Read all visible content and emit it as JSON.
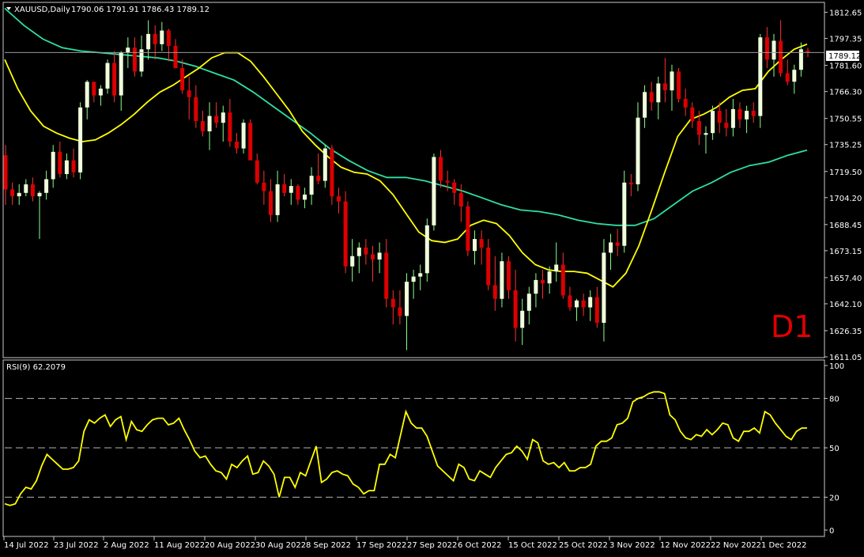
{
  "header": {
    "symbol_label": "XAUUSD,Daily",
    "ohlc": "1790.06 1791.91 1786.43 1789.12"
  },
  "price_badge": "1789.12",
  "timeframe_label": "D1",
  "rsi_label": "RSI(9) 62.2079",
  "price_axis_labels": [
    "1812.65",
    "1797.35",
    "1781.60",
    "1766.30",
    "1750.55",
    "1735.25",
    "1719.50",
    "1704.20",
    "1688.45",
    "1673.15",
    "1657.40",
    "1642.10",
    "1626.35",
    "1611.05"
  ],
  "rsi_axis_labels": [
    "100",
    "80",
    "50",
    "20",
    "0"
  ],
  "date_labels": [
    "14 Jul 2022",
    "23 Jul 2022",
    "2 Aug 2022",
    "11 Aug 2022",
    "20 Aug 2022",
    "30 Aug 2022",
    "8 Sep 2022",
    "17 Sep 2022",
    "27 Sep 2022",
    "6 Oct 2022",
    "15 Oct 2022",
    "25 Oct 2022",
    "3 Nov 2022",
    "12 Nov 2022",
    "22 Nov 2022",
    "1 Dec 2022"
  ],
  "colors": {
    "background": "#000000",
    "bull": "#f0ffdc",
    "bear": "#dc0000",
    "wick_bull": "#8cff8c",
    "wick_bear": "#ff3030",
    "ma_fast": "#ffff00",
    "ma_slow": "#2ee0a0",
    "rsi": "#ffff00",
    "grid": "#b4b4b4",
    "d1": "#e00000"
  },
  "chart_data": [
    {
      "type": "candlestick",
      "title": "XAUUSD,Daily",
      "ylim": [
        1611.05,
        1818
      ],
      "current_price": 1789.12,
      "series": [
        {
          "name": "candles",
          "ohlc": [
            [
              1729,
              1735,
              1700,
              1709
            ],
            [
              1709,
              1713,
              1700,
              1705
            ],
            [
              1705,
              1712,
              1700,
              1707
            ],
            [
              1707,
              1715,
              1705,
              1712
            ],
            [
              1712,
              1716,
              1702,
              1705
            ],
            [
              1705,
              1708,
              1680,
              1707
            ],
            [
              1707,
              1720,
              1703,
              1715
            ],
            [
              1715,
              1735,
              1710,
              1731
            ],
            [
              1731,
              1737,
              1716,
              1718
            ],
            [
              1718,
              1730,
              1715,
              1726
            ],
            [
              1726,
              1733,
              1716,
              1719
            ],
            [
              1719,
              1760,
              1715,
              1757
            ],
            [
              1757,
              1773,
              1750,
              1772
            ],
            [
              1772,
              1772,
              1760,
              1764
            ],
            [
              1764,
              1770,
              1758,
              1768
            ],
            [
              1768,
              1785,
              1765,
              1783
            ],
            [
              1783,
              1790,
              1760,
              1764
            ],
            [
              1764,
              1790,
              1755,
              1789
            ],
            [
              1789,
              1798,
              1780,
              1792
            ],
            [
              1792,
              1798,
              1775,
              1778
            ],
            [
              1778,
              1799,
              1775,
              1791
            ],
            [
              1791,
              1808,
              1785,
              1800
            ],
            [
              1800,
              1805,
              1785,
              1794
            ],
            [
              1794,
              1807,
              1790,
              1802
            ],
            [
              1802,
              1803,
              1784,
              1793
            ],
            [
              1793,
              1797,
              1780,
              1780
            ],
            [
              1780,
              1785,
              1765,
              1767
            ],
            [
              1767,
              1775,
              1750,
              1763
            ],
            [
              1763,
              1770,
              1745,
              1749
            ],
            [
              1749,
              1755,
              1740,
              1743
            ],
            [
              1743,
              1760,
              1732,
              1752
            ],
            [
              1752,
              1760,
              1745,
              1748
            ],
            [
              1748,
              1758,
              1737,
              1754
            ],
            [
              1754,
              1762,
              1734,
              1737
            ],
            [
              1737,
              1742,
              1730,
              1733
            ],
            [
              1733,
              1750,
              1730,
              1748
            ],
            [
              1748,
              1750,
              1728,
              1726
            ],
            [
              1726,
              1730,
              1712,
              1713
            ],
            [
              1713,
              1720,
              1700,
              1708
            ],
            [
              1708,
              1715,
              1690,
              1694
            ],
            [
              1694,
              1720,
              1690,
              1712
            ],
            [
              1712,
              1718,
              1705,
              1707
            ],
            [
              1707,
              1715,
              1700,
              1711
            ],
            [
              1711,
              1712,
              1700,
              1703
            ],
            [
              1703,
              1710,
              1698,
              1706
            ],
            [
              1706,
              1722,
              1700,
              1717
            ],
            [
              1717,
              1730,
              1712,
              1714
            ],
            [
              1714,
              1735,
              1710,
              1733
            ],
            [
              1733,
              1735,
              1700,
              1705
            ],
            [
              1705,
              1710,
              1695,
              1702
            ],
            [
              1702,
              1708,
              1660,
              1664
            ],
            [
              1664,
              1680,
              1655,
              1670
            ],
            [
              1670,
              1678,
              1660,
              1675
            ],
            [
              1675,
              1680,
              1665,
              1671
            ],
            [
              1671,
              1676,
              1655,
              1668
            ],
            [
              1668,
              1678,
              1660,
              1672
            ],
            [
              1672,
              1680,
              1640,
              1645
            ],
            [
              1645,
              1650,
              1630,
              1640
            ],
            [
              1640,
              1650,
              1630,
              1635
            ],
            [
              1635,
              1660,
              1615,
              1655
            ],
            [
              1655,
              1662,
              1645,
              1658
            ],
            [
              1658,
              1665,
              1650,
              1660
            ],
            [
              1660,
              1692,
              1655,
              1688
            ],
            [
              1688,
              1730,
              1685,
              1728
            ],
            [
              1728,
              1732,
              1710,
              1714
            ],
            [
              1714,
              1720,
              1708,
              1713
            ],
            [
              1713,
              1715,
              1700,
              1707
            ],
            [
              1707,
              1712,
              1690,
              1699
            ],
            [
              1699,
              1702,
              1670,
              1673
            ],
            [
              1673,
              1685,
              1665,
              1680
            ],
            [
              1680,
              1685,
              1665,
              1675
            ],
            [
              1675,
              1680,
              1650,
              1653
            ],
            [
              1653,
              1670,
              1638,
              1645
            ],
            [
              1645,
              1672,
              1640,
              1667
            ],
            [
              1667,
              1670,
              1645,
              1650
            ],
            [
              1650,
              1662,
              1620,
              1628
            ],
            [
              1628,
              1645,
              1618,
              1638
            ],
            [
              1638,
              1652,
              1630,
              1648
            ],
            [
              1648,
              1660,
              1640,
              1656
            ],
            [
              1656,
              1662,
              1645,
              1654
            ],
            [
              1654,
              1664,
              1648,
              1661
            ],
            [
              1661,
              1678,
              1655,
              1665
            ],
            [
              1665,
              1672,
              1645,
              1647
            ],
            [
              1647,
              1652,
              1638,
              1640
            ],
            [
              1640,
              1645,
              1632,
              1644
            ],
            [
              1644,
              1648,
              1635,
              1640
            ],
            [
              1640,
              1650,
              1632,
              1646
            ],
            [
              1646,
              1652,
              1628,
              1631
            ],
            [
              1631,
              1680,
              1620,
              1672
            ],
            [
              1672,
              1683,
              1662,
              1678
            ],
            [
              1678,
              1686,
              1670,
              1676
            ],
            [
              1676,
              1720,
              1672,
              1713
            ],
            [
              1713,
              1718,
              1705,
              1712
            ],
            [
              1712,
              1760,
              1708,
              1751
            ],
            [
              1751,
              1770,
              1745,
              1766
            ],
            [
              1766,
              1772,
              1755,
              1760
            ],
            [
              1760,
              1775,
              1750,
              1771
            ],
            [
              1771,
              1786,
              1760,
              1767
            ],
            [
              1767,
              1782,
              1755,
              1778
            ],
            [
              1778,
              1780,
              1760,
              1762
            ],
            [
              1762,
              1768,
              1752,
              1757
            ],
            [
              1757,
              1760,
              1745,
              1749
            ],
            [
              1749,
              1755,
              1735,
              1741
            ],
            [
              1741,
              1746,
              1730,
              1742
            ],
            [
              1742,
              1758,
              1738,
              1755
            ],
            [
              1755,
              1760,
              1742,
              1748
            ],
            [
              1748,
              1756,
              1740,
              1745
            ],
            [
              1745,
              1762,
              1740,
              1756
            ],
            [
              1756,
              1760,
              1745,
              1750
            ],
            [
              1750,
              1758,
              1742,
              1755
            ],
            [
              1755,
              1760,
              1748,
              1752
            ],
            [
              1752,
              1800,
              1745,
              1798
            ],
            [
              1798,
              1804,
              1780,
              1785
            ],
            [
              1785,
              1800,
              1775,
              1796
            ],
            [
              1796,
              1808,
              1775,
              1777
            ],
            [
              1777,
              1785,
              1770,
              1772
            ],
            [
              1772,
              1782,
              1765,
              1779
            ],
            [
              1779,
              1795,
              1775,
              1791
            ],
            [
              1790.06,
              1791.91,
              1786.43,
              1789.12
            ]
          ]
        },
        {
          "name": "ma_fast",
          "values": [
            1785,
            1768,
            1755,
            1746,
            1742,
            1739,
            1737,
            1738,
            1742,
            1747,
            1753,
            1760,
            1766,
            1770,
            1775,
            1780,
            1786,
            1789,
            1789,
            1784,
            1775,
            1765,
            1755,
            1743,
            1735,
            1728,
            1722,
            1719,
            1718,
            1714,
            1706,
            1695,
            1684,
            1679,
            1678,
            1680,
            1688,
            1691,
            1689,
            1682,
            1672,
            1665,
            1662,
            1661,
            1661,
            1660,
            1656,
            1652,
            1660,
            1676,
            1697,
            1719,
            1740,
            1750,
            1753,
            1757,
            1763,
            1767,
            1768,
            1778,
            1785,
            1791,
            1794
          ]
        },
        {
          "name": "ma_slow",
          "values": [
            1815,
            1805,
            1797,
            1792,
            1790,
            1789,
            1788,
            1787,
            1786,
            1784,
            1781,
            1777,
            1773,
            1766,
            1758,
            1750,
            1742,
            1733,
            1726,
            1720,
            1716,
            1716,
            1714,
            1711,
            1708,
            1704,
            1700,
            1697,
            1696,
            1694,
            1691,
            1689,
            1688,
            1688,
            1692,
            1700,
            1708,
            1713,
            1719,
            1723,
            1725,
            1729,
            1732
          ]
        }
      ]
    },
    {
      "type": "line",
      "title": "RSI(9) 62.2079",
      "ylim": [
        0,
        100
      ],
      "levels": [
        80,
        50,
        20
      ],
      "series": [
        {
          "name": "RSI(9)",
          "values": [
            16,
            15,
            16,
            22,
            26,
            25,
            30,
            39,
            46,
            43,
            40,
            37,
            37,
            38,
            42,
            60,
            67,
            65,
            68,
            70,
            63,
            67,
            69,
            55,
            66,
            61,
            60,
            64,
            67,
            68,
            68,
            64,
            65,
            68,
            61,
            55,
            48,
            44,
            45,
            40,
            36,
            35,
            31,
            40,
            38,
            42,
            45,
            34,
            35,
            42,
            39,
            34,
            20,
            32,
            32,
            26,
            35,
            33,
            42,
            51,
            29,
            31,
            35,
            36,
            34,
            33,
            28,
            26,
            22,
            24,
            24,
            40,
            40,
            46,
            44,
            58,
            72,
            65,
            62,
            62,
            57,
            48,
            39,
            36,
            33,
            30,
            40,
            38,
            31,
            30,
            36,
            34,
            32,
            38,
            42,
            46,
            47,
            51,
            48,
            43,
            55,
            53,
            42,
            40,
            41,
            38,
            41,
            36,
            36,
            38,
            38,
            40,
            51,
            54,
            54,
            56,
            64,
            65,
            68,
            78,
            80,
            81,
            83,
            84,
            84,
            83,
            70,
            67,
            60,
            56,
            55,
            58,
            57,
            61,
            58,
            61,
            65,
            64,
            56,
            54,
            60,
            60,
            62,
            59,
            72,
            70,
            65,
            61,
            57,
            55,
            60,
            62,
            62
          ]
        }
      ]
    }
  ]
}
